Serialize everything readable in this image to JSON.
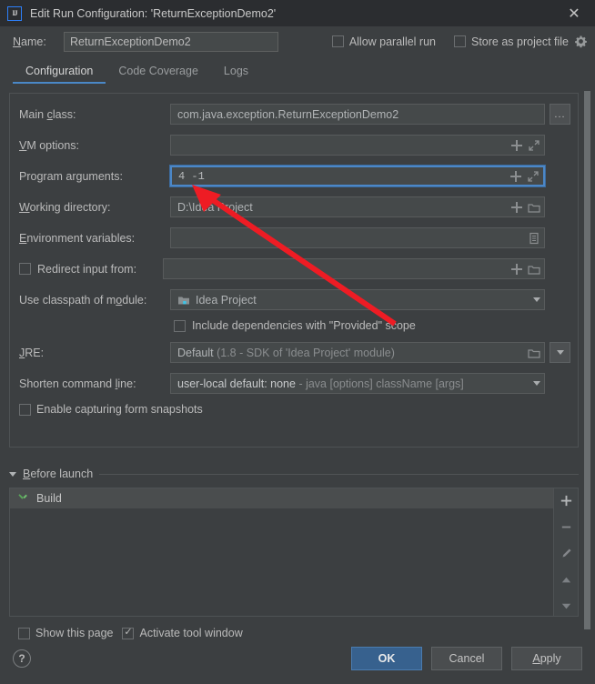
{
  "window": {
    "title": "Edit Run Configuration: 'ReturnExceptionDemo2'",
    "logo_text": "IJ",
    "logo_icon": "intellij-idea-icon",
    "close_icon": "close-icon",
    "accent_color": "#4a88c7",
    "background_color": "#3c3f41",
    "titlebar_color": "#2b2d30",
    "annotation_arrow_color": "#ee1c24"
  },
  "name_row": {
    "label": "Name:",
    "value": "ReturnExceptionDemo2",
    "placeholder": "",
    "allow_parallel_run": {
      "label": "Allow parallel run",
      "checked": false
    },
    "store_as_project_file": {
      "label": "Store as project file",
      "checked": false,
      "gear_icon": "gear-icon"
    }
  },
  "tabs": [
    {
      "label": "Configuration",
      "active": true
    },
    {
      "label": "Code Coverage",
      "active": false
    },
    {
      "label": "Logs",
      "active": false
    }
  ],
  "configuration": {
    "main_class": {
      "label": "Main class:",
      "value": "com.java.exception.ReturnExceptionDemo2",
      "browse_label": "...",
      "browse_icon": "ellipsis-button-icon"
    },
    "vm_options": {
      "label": "VM options:",
      "value": "",
      "icons": [
        "plus-icon",
        "expand-icon"
      ]
    },
    "program_arguments": {
      "label": "Program arguments:",
      "value": "4 -1",
      "focused": true,
      "icons": [
        "plus-icon",
        "expand-icon"
      ]
    },
    "working_directory": {
      "label": "Working directory:",
      "value": "D:\\Idea Project",
      "icons": [
        "plus-icon",
        "folder-icon"
      ]
    },
    "environment_variables": {
      "label": "Environment variables:",
      "value": "",
      "icons": [
        "list-editor-icon"
      ]
    },
    "redirect_input_from": {
      "label": "Redirect input from:",
      "checked": false,
      "value": "",
      "icons": [
        "plus-icon",
        "folder-icon"
      ]
    },
    "use_classpath_of_module": {
      "label": "Use classpath of module:",
      "value": "Idea Project",
      "module_icon": "module-icon",
      "dropdown_icon": "chevron-down-icon"
    },
    "include_provided_scope": {
      "label": "Include dependencies with \"Provided\" scope",
      "checked": false
    },
    "jre": {
      "label": "JRE:",
      "value": "Default",
      "value_detail": "(1.8 - SDK of 'Idea Project' module)",
      "icons": [
        "folder-icon",
        "chevron-down-icon"
      ]
    },
    "shorten_command_line": {
      "label": "Shorten command line:",
      "value": "user-local default: none",
      "value_detail": "- java [options] className [args]",
      "dropdown_icon": "chevron-down-icon"
    },
    "enable_capturing_form_snapshots": {
      "label": "Enable capturing form snapshots",
      "checked": false
    }
  },
  "before_launch": {
    "title": "Before launch",
    "expanded": true,
    "items": [
      {
        "label": "Build",
        "icon": "build-hammer-icon"
      }
    ],
    "toolbar": [
      {
        "name": "add-button",
        "icon": "plus-icon"
      },
      {
        "name": "remove-button",
        "icon": "minus-icon"
      },
      {
        "name": "edit-button",
        "icon": "pencil-icon"
      },
      {
        "name": "move-up-button",
        "icon": "arrow-up-icon"
      },
      {
        "name": "move-down-button",
        "icon": "arrow-down-icon"
      }
    ]
  },
  "bottom_options": {
    "show_this_page": {
      "label": "Show this page",
      "checked": false
    },
    "activate_tool_window": {
      "label": "Activate tool window",
      "checked": true
    }
  },
  "footer": {
    "help_label": "?",
    "ok_label": "OK",
    "cancel_label": "Cancel",
    "apply_label": "Apply"
  }
}
